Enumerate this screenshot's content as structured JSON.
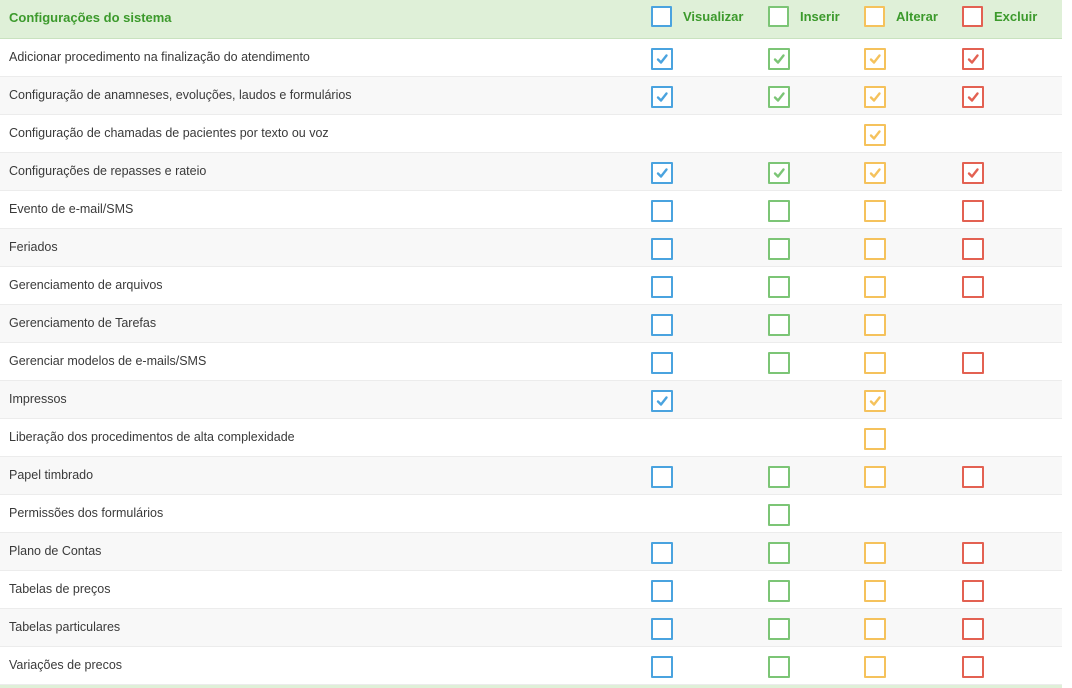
{
  "header": {
    "title": "Configurações do sistema",
    "columns": [
      {
        "key": "v",
        "label": "Visualizar",
        "color": "#4aa3df"
      },
      {
        "key": "i",
        "label": "Inserir",
        "color": "#7cc576"
      },
      {
        "key": "a",
        "label": "Alterar",
        "color": "#f5c25c"
      },
      {
        "key": "e",
        "label": "Excluir",
        "color": "#e36152"
      }
    ]
  },
  "rows": [
    {
      "label": "Adicionar procedimento na finalização do atendimento",
      "v": "checked",
      "i": "checked",
      "a": "checked",
      "e": "checked"
    },
    {
      "label": "Configuração de anamneses, evoluções, laudos e formulários",
      "v": "checked",
      "i": "checked",
      "a": "checked",
      "e": "checked"
    },
    {
      "label": "Configuração de chamadas de pacientes por texto ou voz",
      "v": "none",
      "i": "none",
      "a": "checked",
      "e": "none"
    },
    {
      "label": "Configurações de repasses e rateio",
      "v": "checked",
      "i": "checked",
      "a": "checked",
      "e": "checked"
    },
    {
      "label": "Evento de e-mail/SMS",
      "v": "unchecked",
      "i": "unchecked",
      "a": "unchecked",
      "e": "unchecked"
    },
    {
      "label": "Feriados",
      "v": "unchecked",
      "i": "unchecked",
      "a": "unchecked",
      "e": "unchecked"
    },
    {
      "label": "Gerenciamento de arquivos",
      "v": "unchecked",
      "i": "unchecked",
      "a": "unchecked",
      "e": "unchecked"
    },
    {
      "label": "Gerenciamento de Tarefas",
      "v": "unchecked",
      "i": "unchecked",
      "a": "unchecked",
      "e": "none"
    },
    {
      "label": "Gerenciar modelos de e-mails/SMS",
      "v": "unchecked",
      "i": "unchecked",
      "a": "unchecked",
      "e": "unchecked"
    },
    {
      "label": "Impressos",
      "v": "checked",
      "i": "none",
      "a": "checked",
      "e": "none"
    },
    {
      "label": "Liberação dos procedimentos de alta complexidade",
      "v": "none",
      "i": "none",
      "a": "unchecked",
      "e": "none"
    },
    {
      "label": "Papel timbrado",
      "v": "unchecked",
      "i": "unchecked",
      "a": "unchecked",
      "e": "unchecked"
    },
    {
      "label": "Permissões dos formulários",
      "v": "none",
      "i": "unchecked",
      "a": "none",
      "e": "none"
    },
    {
      "label": "Plano de Contas",
      "v": "unchecked",
      "i": "unchecked",
      "a": "unchecked",
      "e": "unchecked"
    },
    {
      "label": "Tabelas de preços",
      "v": "unchecked",
      "i": "unchecked",
      "a": "unchecked",
      "e": "unchecked"
    },
    {
      "label": "Tabelas particulares",
      "v": "unchecked",
      "i": "unchecked",
      "a": "unchecked",
      "e": "unchecked"
    },
    {
      "label": "Variações de precos",
      "v": "unchecked",
      "i": "unchecked",
      "a": "unchecked",
      "e": "unchecked"
    }
  ]
}
